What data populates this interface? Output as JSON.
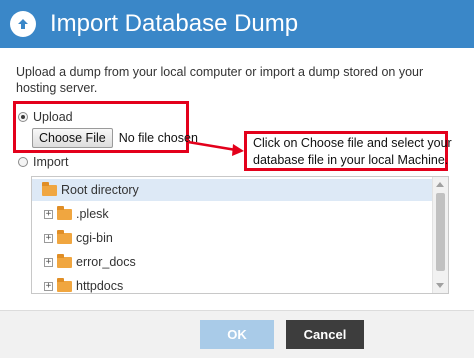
{
  "dialog": {
    "title": "Import Database Dump",
    "description": "Upload a dump from your local computer or import a dump stored on your hosting server."
  },
  "upload": {
    "radio_label": "Upload",
    "choose_button": "Choose File",
    "file_status": "No file chosen"
  },
  "annotation": {
    "line1": "Click on Choose file and select your",
    "line2": "database file in your local Machine."
  },
  "import": {
    "radio_label": "Import",
    "root_label": "Root directory",
    "items": [
      {
        "label": ".plesk"
      },
      {
        "label": "cgi-bin"
      },
      {
        "label": "error_docs"
      },
      {
        "label": "httpdocs"
      }
    ]
  },
  "footer": {
    "ok_label": "OK",
    "cancel_label": "Cancel"
  },
  "colors": {
    "title_bar": "#3a87c8",
    "highlight": "#e3001b",
    "ok_disabled": "#a9cbe8",
    "cancel": "#3d3d3d",
    "folder": "#f0a640"
  }
}
